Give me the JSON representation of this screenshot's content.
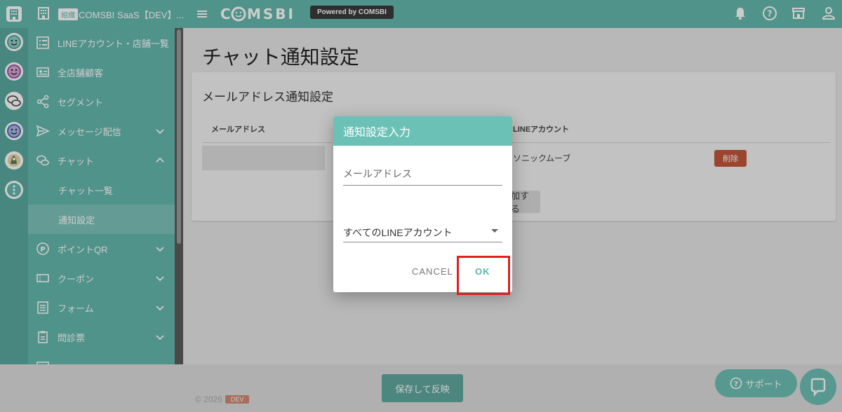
{
  "header": {
    "org_badge": "組織",
    "org_name": "COMSBI SaaS【DEV】...",
    "brand": "COMSBI",
    "powered_by": "Powered by COMSBI"
  },
  "sidebar": {
    "items": [
      {
        "label": "LINEアカウント・店舗一覧",
        "icon": "list-icon"
      },
      {
        "label": "全店舗顧客",
        "icon": "id-card-icon"
      },
      {
        "label": "セグメント",
        "icon": "share-icon"
      },
      {
        "label": "メッセージ配信",
        "icon": "send-icon"
      },
      {
        "label": "チャット",
        "icon": "chat-icon"
      },
      {
        "label": "チャット一覧"
      },
      {
        "label": "通知設定"
      },
      {
        "label": "ポイントQR",
        "icon": "point-icon"
      },
      {
        "label": "クーポン",
        "icon": "coupon-icon"
      },
      {
        "label": "フォーム",
        "icon": "form-icon"
      },
      {
        "label": "問診票",
        "icon": "clipboard-icon"
      }
    ]
  },
  "main": {
    "page_title": "チャット通知設定",
    "card_title": "メールアドレス通知設定",
    "columns": [
      "メールアドレス",
      "LINEアカウント"
    ],
    "row_account": "ソニックムーブ",
    "delete_label": "削除",
    "add_label": "加する"
  },
  "dialog": {
    "title": "通知設定入力",
    "email_placeholder": "メールアドレス",
    "account_select_value": "すべてのLINEアカウント",
    "cancel_label": "CANCEL",
    "ok_label": "OK"
  },
  "footer": {
    "copyright": "© 2026",
    "dev_tag": "DEV",
    "save_label": "保存して反映",
    "support_label": "サポート"
  },
  "colors": {
    "teal": "#64b8ad",
    "dialog_header": "#6cc1b6",
    "delete": "#c1573a",
    "highlight": "#e02020"
  }
}
